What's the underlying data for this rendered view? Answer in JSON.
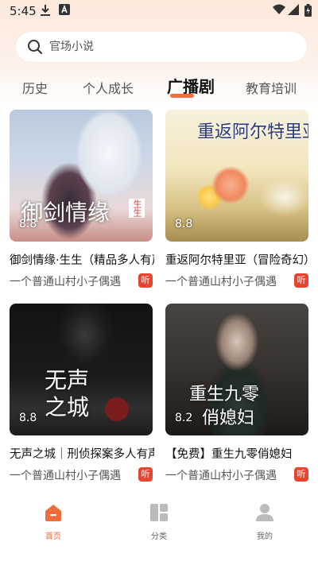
{
  "status_bar": {
    "time": "5:45"
  },
  "search": {
    "placeholder": "官场小说"
  },
  "tabs": [
    {
      "label": "历史",
      "active": false
    },
    {
      "label": "个人成长",
      "active": false
    },
    {
      "label": "广播剧",
      "active": true
    },
    {
      "label": "教育培训",
      "active": false
    }
  ],
  "accent_color": "#f26b3a",
  "badge_color": "#e8442f",
  "cards": [
    {
      "cover_title": "御剑情缘",
      "cover_sub": "生生",
      "score": "8.8",
      "title": "御剑情缘·生生（精品多人有声剧）",
      "author": "一个普通山村小子偶遇",
      "badge": "听"
    },
    {
      "cover_title": "重返阿尔特里亚",
      "cover_sub": "",
      "score": "8.8",
      "title": "重返阿尔特里亚（冒险奇幻）",
      "author": "一个普通山村小子偶遇",
      "badge": "听"
    },
    {
      "cover_title": "无声之城",
      "cover_sub": "",
      "score": "8.8",
      "title": "无声之城｜刑侦探案多人有声剧",
      "author": "一个普通山村小子偶遇",
      "badge": "听"
    },
    {
      "cover_title": "重生九零",
      "cover_sub": "俏媳妇",
      "score": "8.2",
      "title": "【免费】重生九零俏媳妇",
      "author": "一个普通山村小子偶遇",
      "badge": "听"
    }
  ],
  "bottom_nav": [
    {
      "label": "首页",
      "icon": "home-icon",
      "active": true
    },
    {
      "label": "分类",
      "icon": "category-icon",
      "active": false
    },
    {
      "label": "我的",
      "icon": "profile-icon",
      "active": false
    }
  ]
}
